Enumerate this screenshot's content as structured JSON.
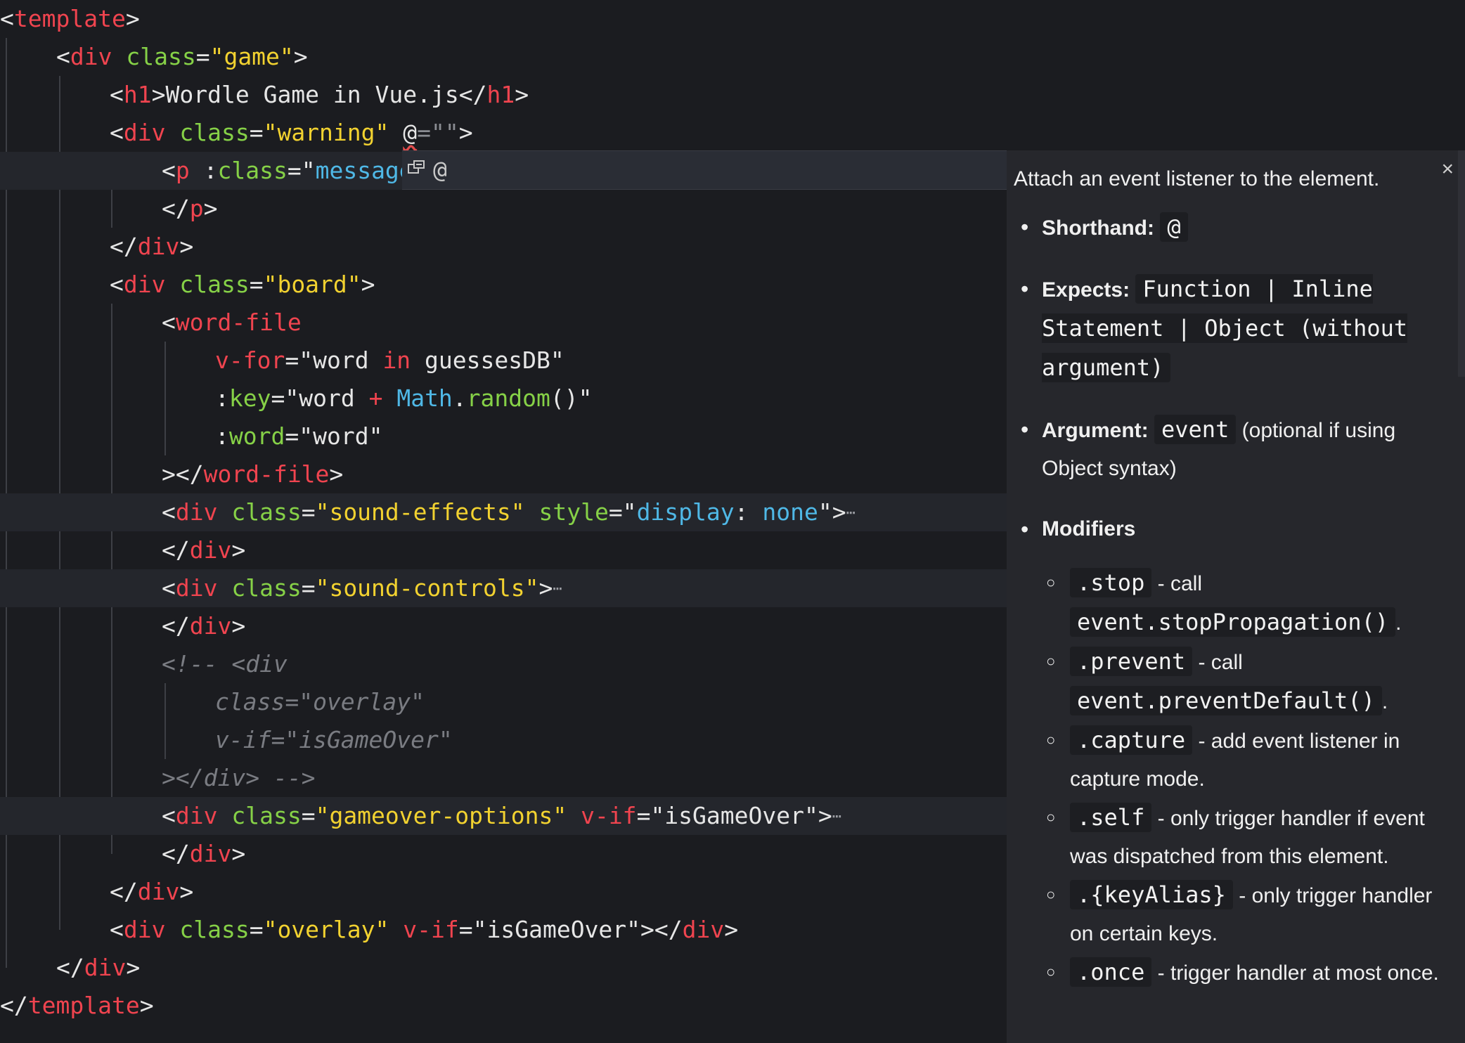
{
  "code": {
    "template_tag": "template",
    "div_tag": "div",
    "h1_tag": "h1",
    "p_tag": "p",
    "word_file_tag": "word-file",
    "class_attr": "class",
    "style_attr": "style",
    "vif_attr": "v-if",
    "vfor_attr": "v-for",
    "key_attr": "key",
    "word_attr": "word",
    "game_class": "\"game\"",
    "h1_text": "Wordle Game in Vue.js",
    "warning_class": "\"warning\"",
    "at_sign": "@",
    "at_rest": "=\"\"",
    "message_partial": "message",
    "board_class": "\"board\"",
    "vfor_open": "\"word ",
    "in_kw": "in",
    "vfor_close": " guessesDB\"",
    "key_open": "\"word ",
    "plus": "+",
    "math": "Math",
    "random": "random",
    "key_close": "()\"",
    "word_val": "\"word\"",
    "sound_effects_class": "\"sound-effects\"",
    "style_prop": "display",
    "style_colon": ":",
    "style_val": "none",
    "sound_controls_class": "\"sound-controls\"",
    "comment_open": "<!-- <div",
    "comment_class": "class=\"overlay\"",
    "comment_vif": "v-if=\"isGameOver\"",
    "comment_close": "></div> -->",
    "gameover_class": "\"gameover-options\"",
    "isgameover_val": "\"isGameOver\"",
    "overlay_class": "\"overlay\"",
    "ellipsis": "⋯"
  },
  "suggest": {
    "icon": "field-icon",
    "label": "@"
  },
  "docs": {
    "close": "×",
    "description": "Attach an event listener to the element.",
    "shorthand_label": "Shorthand:",
    "shorthand_code": "@",
    "expects_label": "Expects:",
    "expects_code": "Function | Inline Statement | Object (without argument)",
    "argument_label": "Argument:",
    "argument_code": "event",
    "argument_note": "(optional if using Object syntax)",
    "modifiers_label": "Modifiers",
    "modifiers": [
      {
        "code": ".stop",
        "desc": "- call",
        "code2": "event.stopPropagation()",
        "tail": "."
      },
      {
        "code": ".prevent",
        "desc": "- call",
        "code2": "event.preventDefault()",
        "tail": "."
      },
      {
        "code": ".capture",
        "desc": "- add event listener in capture mode."
      },
      {
        "code": ".self",
        "desc": "- only trigger handler if event was dispatched from this element."
      },
      {
        "code": ".{keyAlias}",
        "desc": "- only trigger handler on certain keys."
      },
      {
        "code": ".once",
        "desc": "- trigger handler at most once."
      }
    ]
  }
}
